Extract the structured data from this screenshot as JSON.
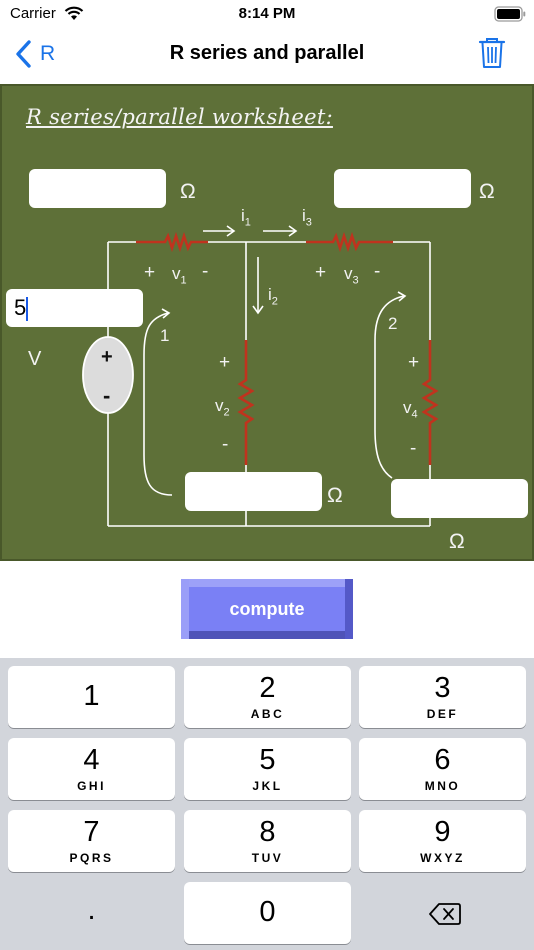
{
  "status_bar": {
    "carrier": "Carrier",
    "time": "8:14 PM"
  },
  "nav": {
    "back_label": "R",
    "title": "R series and parallel",
    "back_icon": "chevron-left-icon",
    "trash_icon": "trash-icon"
  },
  "worksheet": {
    "title": "R series/parallel worksheet:",
    "fields": {
      "r1": "",
      "r3": "",
      "voltage": "5",
      "r2": "",
      "r4": ""
    },
    "units": {
      "ohm": "Ω",
      "volt": "V"
    },
    "labels": {
      "i1_i": "i",
      "i1_sub": "1",
      "i3_i": "i",
      "i3_sub": "3",
      "i2_i": "i",
      "i2_sub": "2",
      "v1_v": "v",
      "v1_sub": "1",
      "v3_v": "v",
      "v3_sub": "3",
      "v2_v": "v",
      "v2_sub": "2",
      "v4_v": "v",
      "v4_sub": "4",
      "plus": "+",
      "minus": "-",
      "loop1": "1",
      "loop2": "2"
    }
  },
  "compute_label": "compute",
  "keypad": {
    "keys": [
      {
        "num": "1",
        "letters": ""
      },
      {
        "num": "2",
        "letters": "ABC"
      },
      {
        "num": "3",
        "letters": "DEF"
      },
      {
        "num": "4",
        "letters": "GHI"
      },
      {
        "num": "5",
        "letters": "JKL"
      },
      {
        "num": "6",
        "letters": "MNO"
      },
      {
        "num": "7",
        "letters": "PQRS"
      },
      {
        "num": "8",
        "letters": "TUV"
      },
      {
        "num": "9",
        "letters": "WXYZ"
      },
      {
        "num": ".",
        "letters": ""
      },
      {
        "num": "0",
        "letters": ""
      }
    ],
    "delete_icon": "backspace-icon"
  }
}
